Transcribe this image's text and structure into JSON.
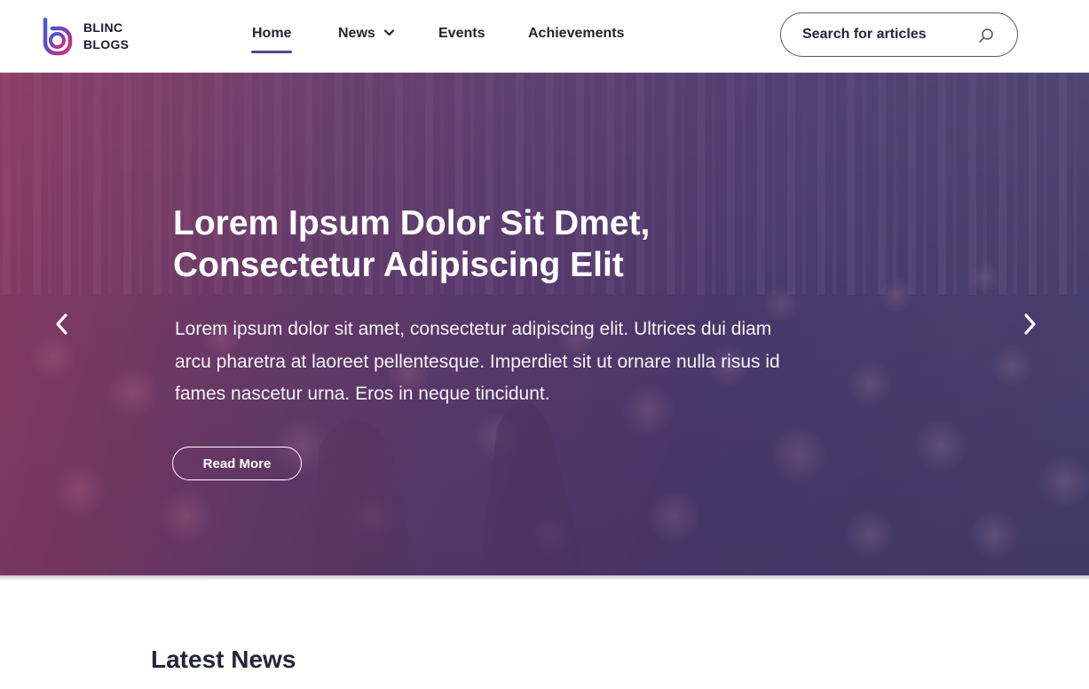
{
  "brand": {
    "line1": "BLINC",
    "line2": "BLOGS",
    "icon": "blinc-logo-icon",
    "colors": {
      "magenta": "#d6336c",
      "blue": "#3f5fd6"
    }
  },
  "nav": {
    "items": [
      {
        "label": "Home",
        "active": true
      },
      {
        "label": "News",
        "dropdown": true
      },
      {
        "label": "Events"
      },
      {
        "label": "Achievements"
      }
    ],
    "accent": "#4e4a8f"
  },
  "search": {
    "placeholder": "Search for articles",
    "value": "",
    "icon": "search-icon"
  },
  "hero": {
    "title_line1": "Lorem Ipsum Dolor Sit Dmet,",
    "title_line2": "Consectetur Adipiscing Elit",
    "text": "Lorem ipsum dolor sit amet, consectetur adipiscing elit. Ultrices dui diam arcu pharetra at laoreet pellentesque. Imperdiet sit ut ornare nulla risus id fames nascetur urna. Eros in neque tincidunt.",
    "cta": "Read More",
    "prev_icon": "chevron-left-icon",
    "next_icon": "chevron-right-icon"
  },
  "latest": {
    "title": "Latest News"
  }
}
